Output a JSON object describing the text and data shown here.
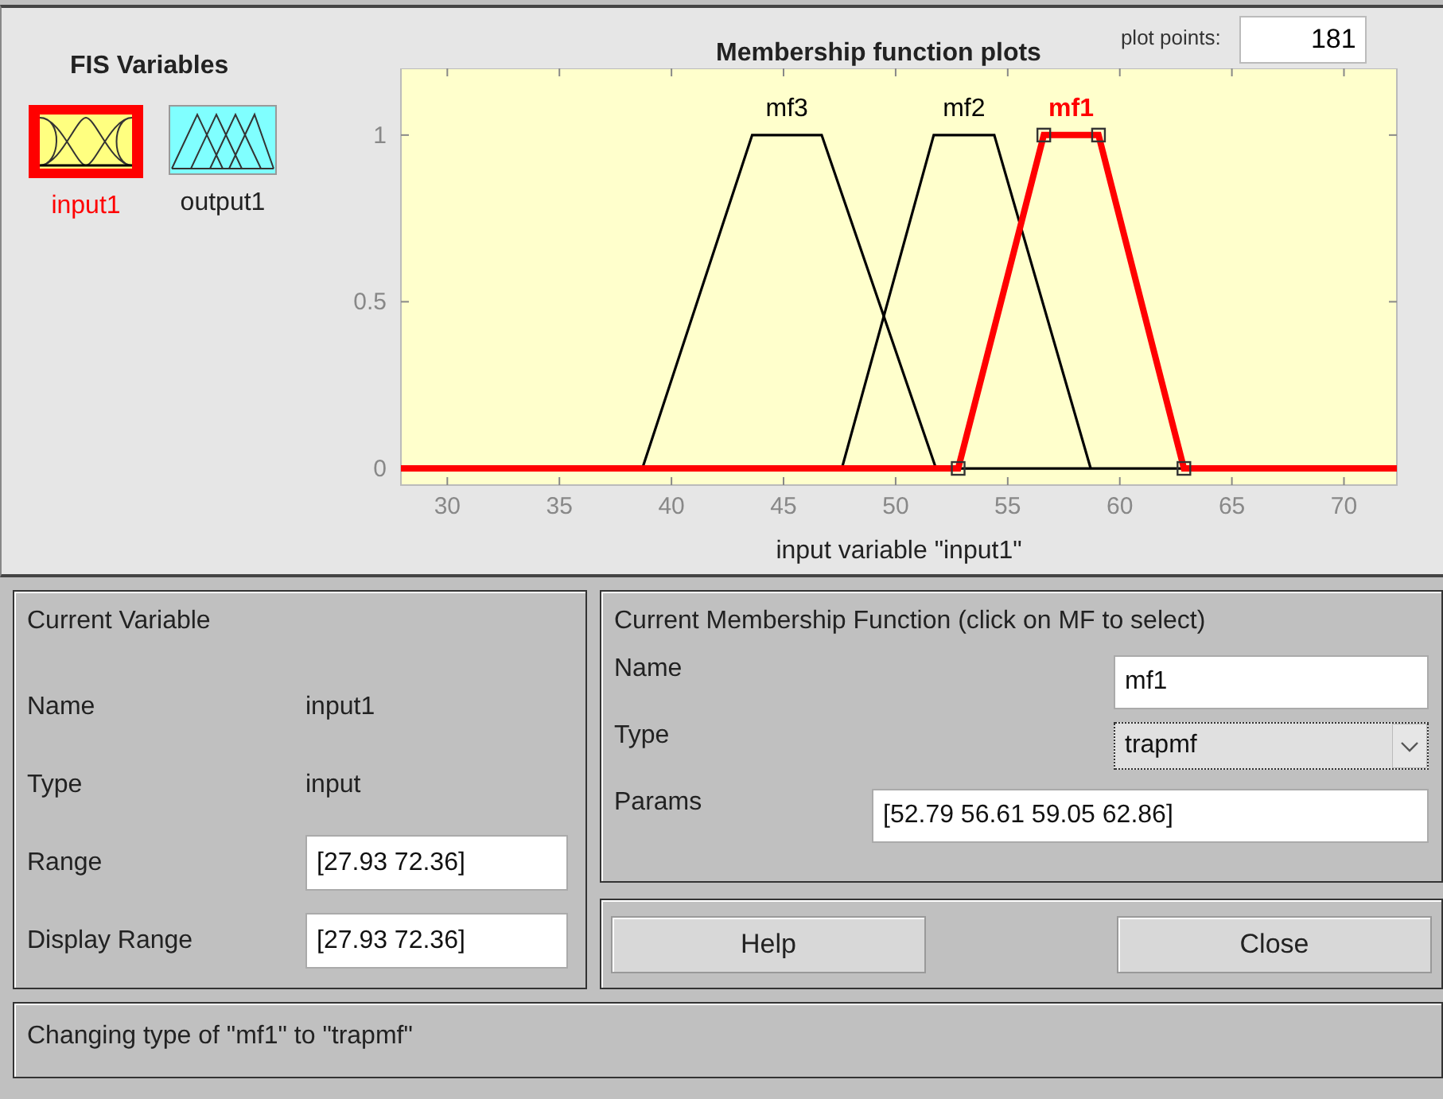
{
  "fis_variables": {
    "title": "FIS Variables",
    "items": [
      {
        "label": "input1",
        "kind": "input",
        "selected": true
      },
      {
        "label": "output1",
        "kind": "output",
        "selected": false
      }
    ]
  },
  "plot": {
    "title": "Membership function plots",
    "plot_points": {
      "label": "plot points:",
      "value": "181"
    },
    "chart_data": {
      "type": "line",
      "xlabel": "input variable \"input1\"",
      "xlim": [
        27.93,
        72.36
      ],
      "ylim": [
        -0.05,
        1.2
      ],
      "xticks": [
        30,
        35,
        40,
        45,
        50,
        55,
        60,
        65,
        70
      ],
      "yticks": [
        0,
        0.5,
        1
      ],
      "series": [
        {
          "name": "mf3",
          "color": "#000000",
          "x": [
            38.7,
            43.6,
            46.7,
            51.8
          ],
          "values": [
            0,
            1,
            1,
            0
          ]
        },
        {
          "name": "mf2",
          "color": "#000000",
          "x": [
            47.6,
            51.7,
            54.4,
            58.7
          ],
          "values": [
            0,
            1,
            1,
            0
          ]
        },
        {
          "name": "mf1",
          "color": "#ff0000",
          "x": [
            27.93,
            52.79,
            56.61,
            59.05,
            62.86,
            72.36
          ],
          "values": [
            0,
            0,
            1,
            1,
            0,
            0
          ]
        }
      ]
    },
    "curves": [
      {
        "selected": false
      },
      {
        "selected": false
      },
      {
        "selected": true
      }
    ]
  },
  "current_variable": {
    "title": "Current Variable",
    "fields": [
      {
        "label": "Name",
        "kind": "text",
        "value": "input1"
      },
      {
        "label": "Type",
        "kind": "text",
        "value": "input"
      },
      {
        "label": "Range",
        "kind": "field",
        "value": "[27.93 72.36]"
      },
      {
        "label": "Display Range",
        "kind": "field",
        "value": "[27.93 72.36]"
      }
    ]
  },
  "current_mf": {
    "title": "Current Membership Function (click on MF to select)",
    "name": {
      "label": "Name",
      "value": "mf1"
    },
    "type": {
      "label": "Type",
      "value": "trapmf"
    },
    "params": {
      "label": "Params",
      "value": "[52.79 56.61 59.05 62.86]"
    }
  },
  "buttons": [
    "Help",
    "Close"
  ],
  "status": "Changing type of \"mf1\" to \"trapmf\""
}
